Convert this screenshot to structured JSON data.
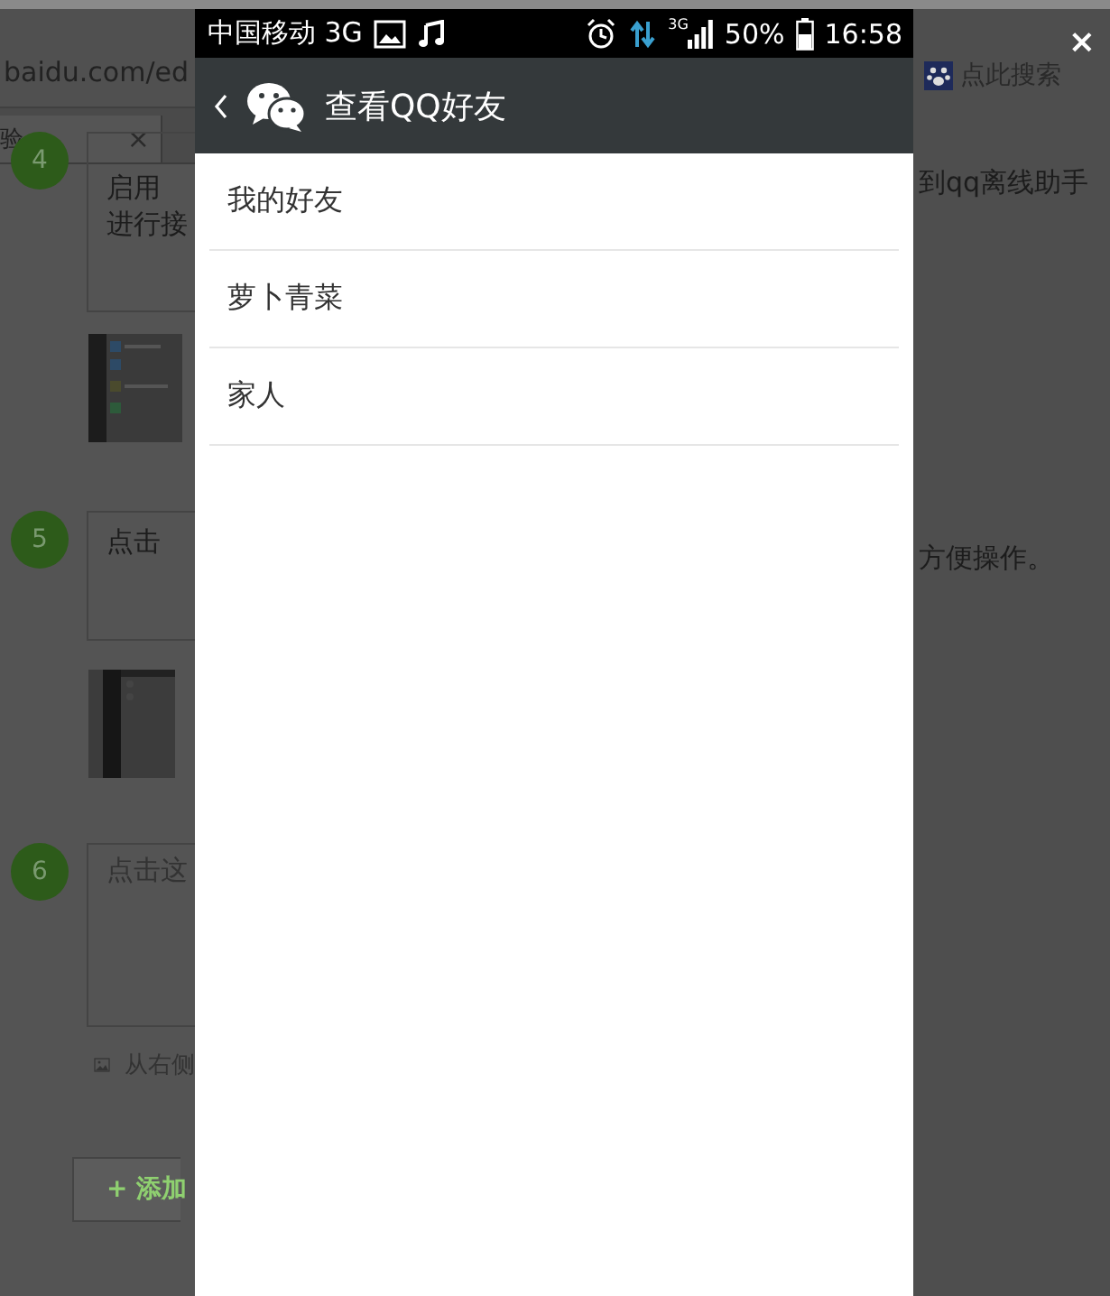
{
  "browser": {
    "url": "baidu.com/ed",
    "search_placeholder": "点此搜索",
    "tab_title": "验",
    "tab_close": "×",
    "window_close": "×"
  },
  "steps": [
    {
      "number": "4",
      "left_text": [
        "启用",
        "进行接"
      ],
      "right_text": "到qq离线助手"
    },
    {
      "number": "5",
      "left_text": [
        "点击"
      ],
      "right_text": "方便操作。"
    },
    {
      "number": "6",
      "placeholder": "点击这"
    }
  ],
  "image_hint": "从右侧",
  "add_button": "+ 添加",
  "phone": {
    "status_bar": {
      "carrier": "中国移动 3G",
      "network": "3G",
      "battery": "50%",
      "time": "16:58"
    },
    "header": {
      "title": "查看QQ好友"
    },
    "groups": [
      {
        "label": "我的好友"
      },
      {
        "label": "萝卜青菜"
      },
      {
        "label": "家人"
      }
    ]
  }
}
